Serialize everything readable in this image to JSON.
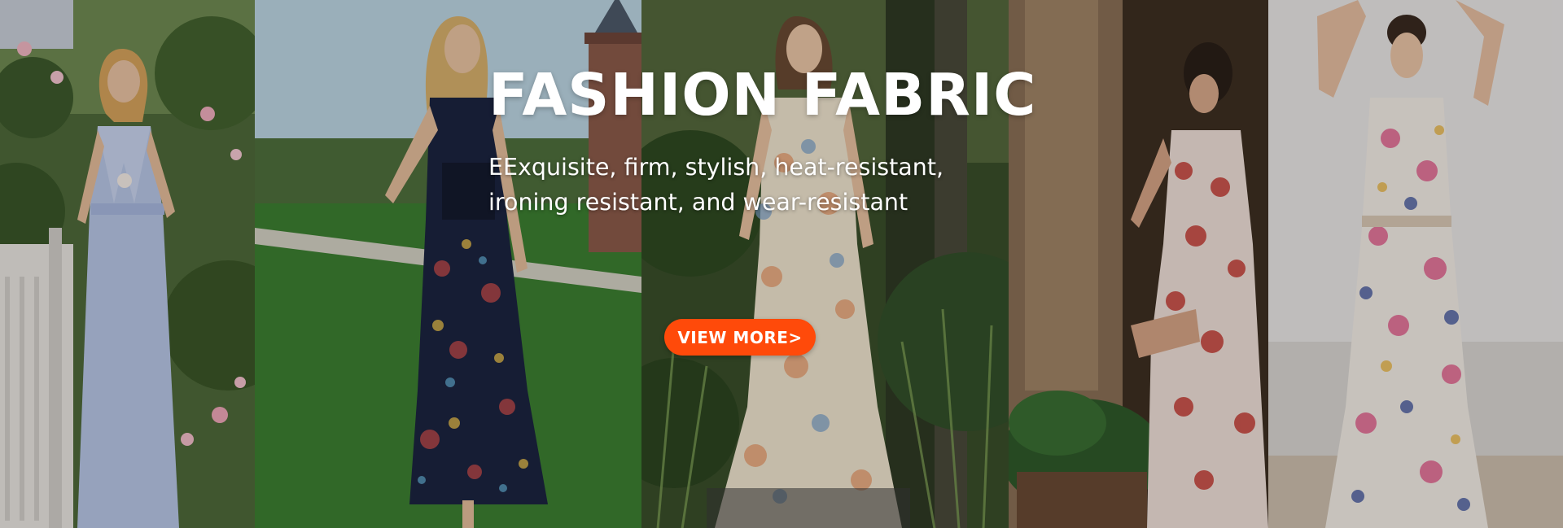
{
  "banner": {
    "title": "FASHION FABRIC",
    "subtitle_line1": "EExquisite, firm, stylish, heat-resistant,",
    "subtitle_line2": "ironing resistant, and wear-resistant",
    "cta_label": "VIEW MORE>"
  },
  "colors": {
    "cta_background": "#ff4a0a",
    "text": "#ffffff"
  },
  "photos": [
    {
      "subject": "woman in pale blue halter maxi dress by white fence with roses"
    },
    {
      "subject": "woman in dark floral print maxi dress on lawn"
    },
    {
      "subject": "woman in cream floral maxi dress in garden"
    },
    {
      "subject": "woman in red and white print halter dress seated on terrace"
    },
    {
      "subject": "woman in butterfly print halter maxi dress"
    }
  ]
}
